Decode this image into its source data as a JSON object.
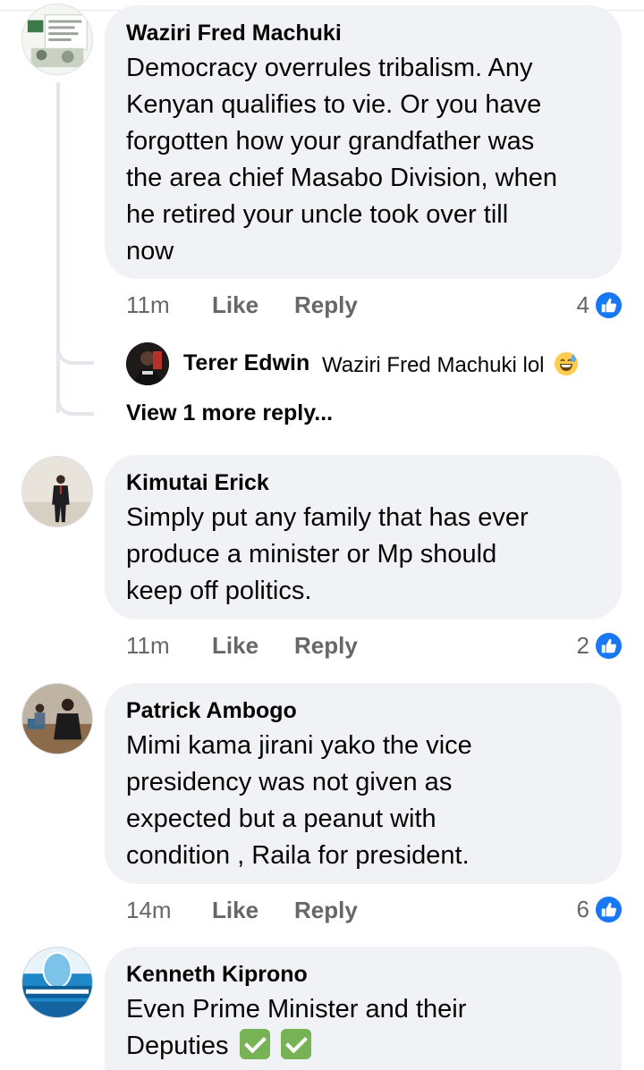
{
  "comments": [
    {
      "author": "Waziri Fred Machuki",
      "lines": [
        "Democracy overrules tribalism. Any",
        "Kenyan qualifies to vie. Or you have",
        "forgotten how your grandfather was",
        "the area chief Masabo Division, when",
        "he retired your uncle took over till",
        "now"
      ],
      "time": "11m",
      "like": "Like",
      "reply": "Reply",
      "reactions": "4",
      "replies": [
        {
          "author": "Terer Edwin",
          "text": "Waziri Fred Machuki lol",
          "emoji": "grinning-sweat-emoji"
        }
      ],
      "view_more": "View 1 more reply..."
    },
    {
      "author": "Kimutai Erick",
      "lines": [
        "Simply put any family that has ever",
        "produce a minister or Mp should",
        "keep off politics."
      ],
      "time": "11m",
      "like": "Like",
      "reply": "Reply",
      "reactions": "2"
    },
    {
      "author": "Patrick Ambogo",
      "lines": [
        "Mimi kama jirani yako the vice",
        "presidency was not given as",
        "expected but a peanut with",
        "condition , Raila for president."
      ],
      "time": "14m",
      "like": "Like",
      "reply": "Reply",
      "reactions": "6"
    },
    {
      "author": "Kenneth Kiprono",
      "lines": [
        "Even Prime Minister and their",
        "Deputies"
      ],
      "emoji": [
        "check-mark-emoji",
        "check-mark-emoji"
      ]
    }
  ],
  "colors": {
    "bubble": "#f0f2f5",
    "meta_text": "#65676b",
    "like_blue": "#1877f2",
    "check_green": "#77b255",
    "thread_line": "#e4e6eb"
  }
}
